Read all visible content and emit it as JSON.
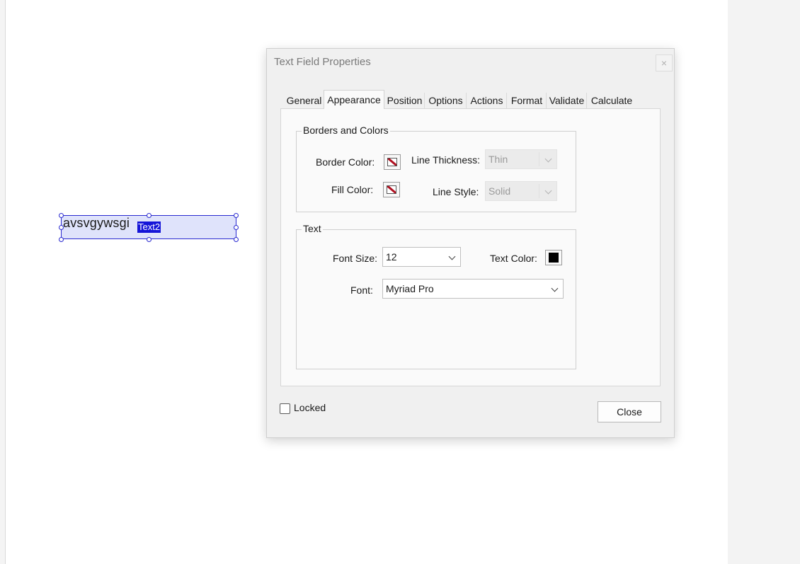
{
  "document": {
    "field_value": "avsvgywsgi",
    "field_name": "Text2"
  },
  "dialog": {
    "title": "Text Field Properties",
    "close_x": "×",
    "tabs": [
      "General",
      "Appearance",
      "Position",
      "Options",
      "Actions",
      "Format",
      "Validate",
      "Calculate"
    ],
    "active_tab": "Appearance",
    "borders_group": {
      "title": "Borders and Colors",
      "border_color_label": "Border Color:",
      "fill_color_label": "Fill Color:",
      "line_thickness_label": "Line Thickness:",
      "line_thickness_value": "Thin",
      "line_style_label": "Line Style:",
      "line_style_value": "Solid"
    },
    "text_group": {
      "title": "Text",
      "font_size_label": "Font Size:",
      "font_size_value": "12",
      "text_color_label": "Text Color:",
      "text_color": "#000000",
      "font_label": "Font:",
      "font_value": "Myriad Pro"
    },
    "locked_label": "Locked",
    "locked_checked": false,
    "close_label": "Close"
  },
  "colors": {
    "field_fill": "#dfe3fb",
    "field_border": "#2a2ad0",
    "field_name_highlight": "#1515d8",
    "no_color_slash": "#b01020"
  }
}
